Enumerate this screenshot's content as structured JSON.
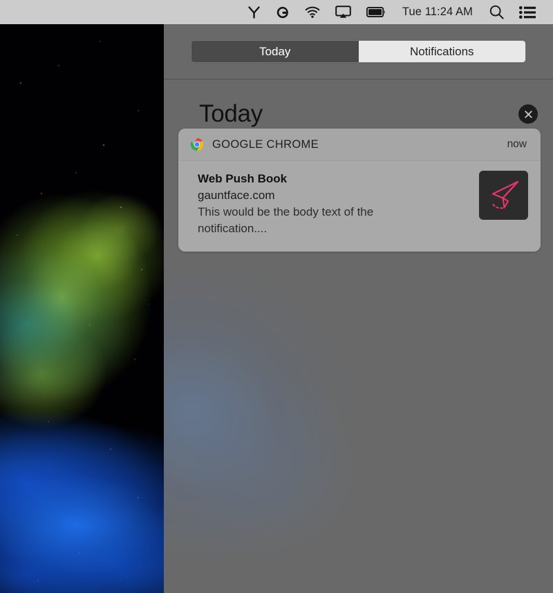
{
  "menubar": {
    "icons": [
      {
        "name": "fork-branch-icon",
        "label": "Fork"
      },
      {
        "name": "google-g-icon",
        "label": "G"
      },
      {
        "name": "wifi-icon",
        "label": "Wi-Fi"
      },
      {
        "name": "airplay-icon",
        "label": "AirPlay"
      },
      {
        "name": "battery-icon",
        "label": "Battery"
      }
    ],
    "clock": "Tue 11:24 AM",
    "search_icon": "search-icon",
    "notification_center_icon": "notification-center-icon",
    "background_color": "#cccccc"
  },
  "notification_center": {
    "tabs": [
      {
        "label": "Today",
        "selected": true
      },
      {
        "label": "Notifications",
        "selected": false
      }
    ],
    "section_title": "Today",
    "close_label": "×",
    "panel_color": "#6c6c6c",
    "accent_color": "#4a4a4a",
    "notifications": [
      {
        "app_name": "GOOGLE CHROME",
        "app_icon": "chrome-icon",
        "timestamp": "now",
        "title": "Web Push Book",
        "origin": "gauntface.com",
        "message": "This would be the body text of the notification....",
        "image_icon": "paper-plane-icon",
        "image_accent_color": "#e8356d",
        "card_color": "#a9a9a9"
      }
    ]
  }
}
